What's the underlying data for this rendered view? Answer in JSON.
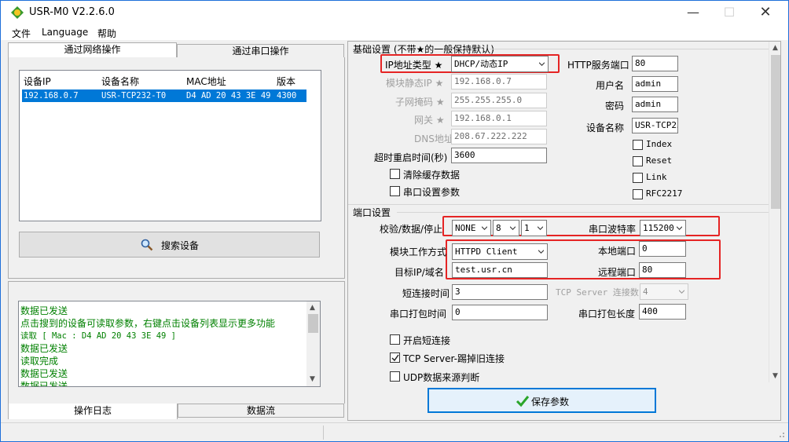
{
  "window": {
    "title": "USR-M0 V2.2.6.0"
  },
  "menu": [
    "文件",
    "Language",
    "帮助"
  ],
  "left_tabs": {
    "network": "通过网络操作",
    "serial": "通过串口操作"
  },
  "device_table": {
    "headers": [
      "设备IP",
      "设备名称",
      "MAC地址",
      "版本"
    ],
    "rows": [
      [
        "192.168.0.7",
        "USR-TCP232-T0",
        "D4 AD 20 43 3E 49",
        "4300"
      ]
    ]
  },
  "search_button": "搜索设备",
  "log_lines": [
    "数据已发送",
    "点击搜到的设备可读取参数，右键点击设备列表显示更多功能",
    "读取 [ Mac : D4 AD 20 43 3E 49 ]",
    "数据已发送",
    "读取完成",
    "数据已发送",
    "数据已发送"
  ],
  "bottom_tabs": {
    "log": "操作日志",
    "stream": "数据流"
  },
  "basic": {
    "group_title": "基础设置 (不带★的一般保持默认)",
    "ip_type_label": "IP地址类型 ★",
    "ip_type_value": "DHCP/动态IP",
    "static_ip_label": "模块静态IP ★",
    "static_ip": "192.168.0.7",
    "mask_label": "子网掩码 ★",
    "mask": "255.255.255.0",
    "gateway_label": "网关 ★",
    "gateway": "192.168.0.1",
    "dns_label": "DNS地址",
    "dns": "208.67.222.222",
    "timeout_label": "超时重启时间(秒)",
    "timeout": "3600",
    "clear_cache_label": "清除缓存数据",
    "serial_params_label": "串口设置参数",
    "http_port_label": "HTTP服务端口",
    "http_port": "80",
    "username_label": "用户名",
    "username": "admin",
    "password_label": "密码",
    "password": "admin",
    "devname_label": "设备名称",
    "devname": "USR-TCP23",
    "opt_index": "Index",
    "opt_reset": "Reset",
    "opt_link": "Link",
    "opt_rfc": "RFC2217"
  },
  "port": {
    "group_title": "端口设置",
    "parity_label": "校验/数据/停止",
    "parity": "NONE",
    "databits": "8",
    "stopbits": "1",
    "baud_label": "串口波特率",
    "baud": "115200",
    "mode_label": "模块工作方式",
    "mode": "HTTPD Client",
    "local_port_label": "本地端口",
    "local_port": "0",
    "target_label": "目标IP/域名",
    "target": "test.usr.cn",
    "remote_port_label": "远程端口",
    "remote_port": "80",
    "short_conn_label": "短连接时间",
    "short_conn": "3",
    "tcp_conn_label": "TCP Server 连接数",
    "tcp_conn": "4",
    "pack_time_label": "串口打包时间",
    "pack_time": "0",
    "pack_len_label": "串口打包长度",
    "pack_len": "400",
    "enable_short_label": "开启短连接",
    "kick_label": "TCP Server-踢掉旧连接",
    "kick_checked": true,
    "udp_label": "UDP数据来源判断"
  },
  "save_button": "保存参数",
  "colors": {
    "accent": "#0078d7",
    "red": "#e52424",
    "log_green": "#008000"
  }
}
